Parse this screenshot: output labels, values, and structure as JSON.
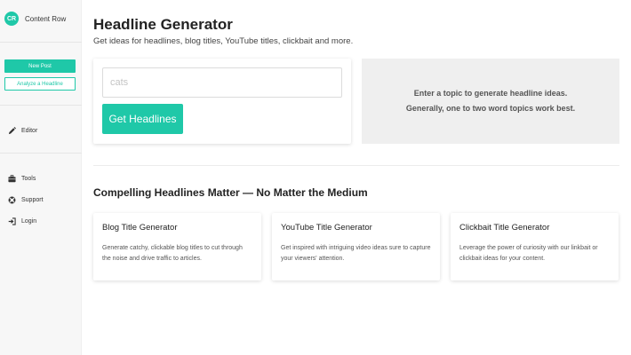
{
  "sidebar": {
    "brand_initials": "CR",
    "brand_name": "Content Row",
    "new_post_label": "New Post",
    "analyze_label": "Analyze a Headline",
    "nav": {
      "editor": "Editor",
      "tools": "Tools",
      "support": "Support",
      "login": "Login"
    },
    "nav_icons": {
      "editor": "pencil-icon",
      "tools": "briefcase-icon",
      "support": "lifebuoy-icon",
      "login": "sign-in-icon"
    }
  },
  "header": {
    "title": "Headline Generator",
    "subtitle": "Get ideas for headlines, blog titles, YouTube titles, clickbait and more."
  },
  "generator": {
    "input_placeholder": "cats",
    "input_value": "",
    "button_label": "Get Headlines",
    "hint_line1": "Enter a topic to generate headline ideas.",
    "hint_line2": "Generally, one to two word topics work best."
  },
  "section": {
    "title": "Compelling Headlines Matter — No Matter the Medium"
  },
  "cards": [
    {
      "title": "Blog Title Generator",
      "description": "Generate catchy, clickable blog titles to cut through the noise and drive traffic to articles."
    },
    {
      "title": "YouTube Title Generator",
      "description": "Get inspired with intriguing video ideas sure to capture your viewers' attention."
    },
    {
      "title": "Clickbait Title Generator",
      "description": "Leverage the power of curiosity with our linkbait or clickbait ideas for your content."
    }
  ],
  "colors": {
    "accent": "#1fc8a8",
    "hint_background": "#efefef",
    "sidebar_background": "#f7f7f7"
  }
}
